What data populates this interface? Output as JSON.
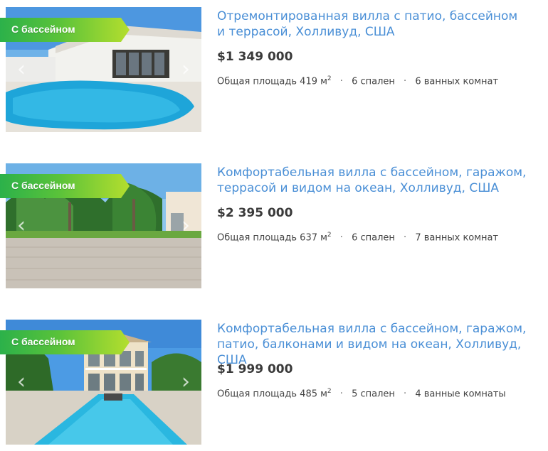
{
  "listings": [
    {
      "badge": "С бассейном",
      "title_line1": "Отремонтированная вилла с патио, бассейном",
      "title_line2": "и террасой, Холливуд, США",
      "price": "$1 349 000",
      "area_label": "Общая площадь 419 м",
      "area_sup": "2",
      "bedrooms": "6 спален",
      "bathrooms": "6 ванных комнат"
    },
    {
      "badge": "С бассейном",
      "title_line1": "Комфортабельная вилла с бассейном, гаражом,",
      "title_line2": "террасой и видом на океан, Холливуд, США",
      "price": "$2 395 000",
      "area_label": "Общая площадь 637 м",
      "area_sup": "2",
      "bedrooms": "6 спален",
      "bathrooms": "7 ванных комнат"
    },
    {
      "badge": "С бассейном",
      "title_line1": "Комфортабельная вилла с бассейном, гаражом,",
      "title_line2": "патио, балконами и видом на океан, Холливуд, США",
      "price": "$1 999 000",
      "area_label": "Общая площадь 485 м",
      "area_sup": "2",
      "bedrooms": "5 спален",
      "bathrooms": "4 ванные комнаты"
    }
  ],
  "icons": {
    "prev": "chevron-left-icon",
    "next": "chevron-right-icon"
  },
  "colors": {
    "title_link": "#4a8fd6",
    "price": "#3a3a3a",
    "badge_start": "#2cb14a",
    "badge_end": "#b4de2e"
  }
}
